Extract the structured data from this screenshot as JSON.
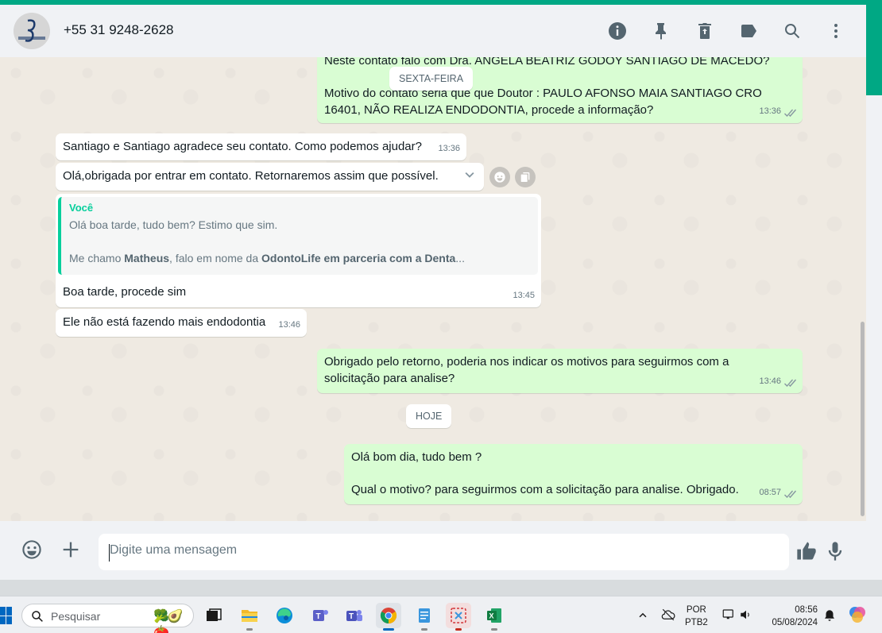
{
  "header": {
    "contact": "+55 31 9248-2628",
    "avatar_text": "Santiago & Santiago",
    "icons": [
      "info-icon",
      "pin-icon",
      "delete-icon",
      "label-icon",
      "search-icon",
      "menu-icon"
    ]
  },
  "chat": {
    "date_friday": "SEXTA-FEIRA",
    "date_today": "HOJE",
    "messages": [
      {
        "dir": "out",
        "line0": "Neste contato falo com Dra. ANGELA BEATRIZ GODOY SANTIAGO DE MACEDO?",
        "line1": "Motivo do contato seria que que Doutor : PAULO AFONSO MAIA SANTIAGO  CRO",
        "line2": "16401, NÃO REALIZA ENDODONTIA, procede a informação?",
        "time": "13:36"
      },
      {
        "dir": "in",
        "text": "Santiago e Santiago agradece seu contato. Como podemos ajudar?",
        "time": "13:36"
      },
      {
        "dir": "in",
        "text": "Olá,obrigada por entrar em contato. Retornaremos assim que possível.",
        "time": "13:36"
      },
      {
        "dir": "in",
        "quote_author": "Você",
        "quote_line1": "Olá boa tarde, tudo bem? Estimo que sim.",
        "quote_line2_a": "Me chamo ",
        "quote_line2_b": "Matheus",
        "quote_line2_c": ", falo em nome da ",
        "quote_line2_d": "OdontoLife em parceria com a Denta",
        "quote_line2_e": "...",
        "text": "Boa tarde, procede sim",
        "time": "13:45"
      },
      {
        "dir": "in",
        "text": "Ele não está fazendo mais endodontia",
        "time": "13:46"
      },
      {
        "dir": "out",
        "line1": "Obrigado pelo retorno, poderia nos indicar os motivos para seguirmos com a",
        "line2": "solicitação para analise?",
        "time": "13:46"
      },
      {
        "dir": "out",
        "line1": "Olá bom dia, tudo bem ?",
        "line2": "Qual o motivo? para seguirmos com a solicitação para analise. Obrigado.",
        "time": "08:57"
      }
    ]
  },
  "composer": {
    "placeholder": "Digite uma mensagem"
  },
  "taskbar": {
    "search_label": "Pesquisar",
    "lang_line1": "POR",
    "lang_line2": "PTB2",
    "time": "08:56",
    "date": "05/08/2024"
  },
  "colors": {
    "accent": "#00a884",
    "outgoing_bubble": "#d9fdd3",
    "incoming_bubble": "#ffffff",
    "chat_bg": "#efeae2"
  }
}
